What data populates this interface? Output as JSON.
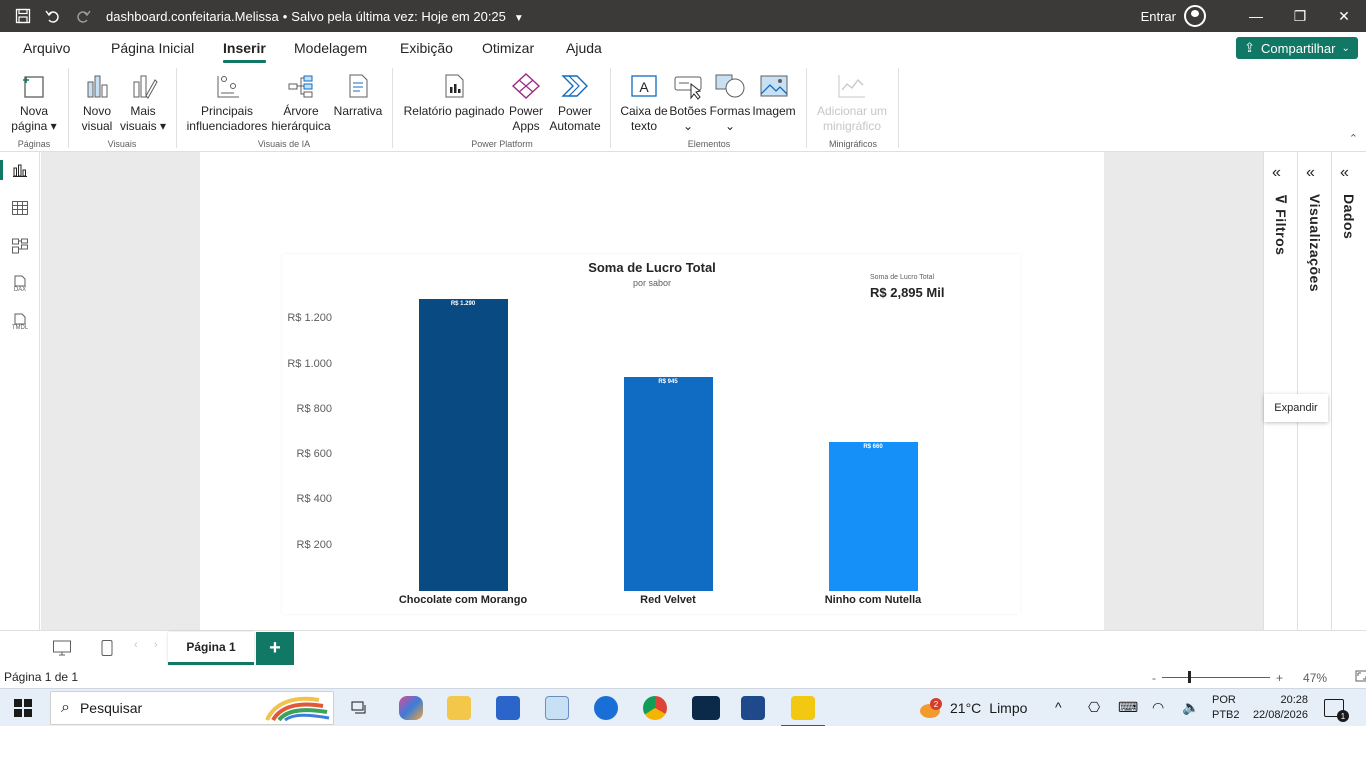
{
  "titlebar": {
    "file_name": "dashboard.confeitaria.Melissa",
    "saved_status": "Salvo pela última vez: Hoje em 20:25",
    "signin_label": "Entrar"
  },
  "menu": {
    "tabs": [
      {
        "label": "Arquivo"
      },
      {
        "label": "Página Inicial"
      },
      {
        "label": "Inserir"
      },
      {
        "label": "Modelagem"
      },
      {
        "label": "Exibição"
      },
      {
        "label": "Otimizar"
      },
      {
        "label": "Ajuda"
      }
    ],
    "share_label": "Compartilhar"
  },
  "ribbon": {
    "groups": [
      {
        "label": "Páginas"
      },
      {
        "label": "Visuais"
      },
      {
        "label": "Visuais de IA"
      },
      {
        "label": "Power Platform"
      },
      {
        "label": "Elementos"
      },
      {
        "label": "Minigráficos"
      }
    ],
    "items": [
      {
        "line1": "Nova",
        "line2": "página ▾"
      },
      {
        "line1": "Novo",
        "line2": "visual"
      },
      {
        "line1": "Mais",
        "line2": "visuais ▾"
      },
      {
        "line1": "Principais",
        "line2": "influenciadores"
      },
      {
        "line1": "Árvore",
        "line2": "hierárquica"
      },
      {
        "line1": "Narrativa",
        "line2": ""
      },
      {
        "line1": "Relatório paginado",
        "line2": ""
      },
      {
        "line1": "Power",
        "line2": "Apps"
      },
      {
        "line1": "Power",
        "line2": "Automate"
      },
      {
        "line1": "Caixa de",
        "line2": "texto"
      },
      {
        "line1": "Botões",
        "line2": "⌄"
      },
      {
        "line1": "Formas",
        "line2": "⌄"
      },
      {
        "line1": "Imagem",
        "line2": ""
      },
      {
        "line1": "Adicionar um",
        "line2": "minigráfico"
      }
    ]
  },
  "leftnav": {
    "dax_label": "DAX",
    "tmdl_label": "TMDL"
  },
  "chart_data": {
    "type": "bar",
    "title": "Soma de Lucro Total",
    "subtitle": "por sabor",
    "categories": [
      "Chocolate com Morango",
      "Red Velvet",
      "Ninho com Nutella"
    ],
    "values": [
      1290,
      945,
      660
    ],
    "data_labels": [
      "R$ 1.290",
      "R$ 945",
      "R$ 660"
    ],
    "yticks": [
      "R$ 200",
      "R$ 400",
      "R$ 600",
      "R$ 800",
      "R$ 1.000",
      "R$ 1.200"
    ],
    "ytick_values": [
      200,
      400,
      600,
      800,
      1000,
      1200
    ],
    "ylim": [
      0,
      1290
    ],
    "bar_colors": [
      "#0a4a82",
      "#0f6cc2",
      "#1590f8"
    ],
    "card": {
      "label": "Soma de Lucro Total",
      "value": "R$ 2,895 Mil"
    }
  },
  "panes": {
    "filters_label": "Filtros",
    "visualizations_label": "Visualizações",
    "data_label": "Dados",
    "tooltip": "Expandir"
  },
  "pagetabs": {
    "active_tab": "Página 1"
  },
  "statusbar": {
    "page_info": "Página 1 de 1",
    "zoom": "47%"
  },
  "taskbar": {
    "search_placeholder": "Pesquisar",
    "weather_temp": "21°C",
    "weather_desc": "Limpo",
    "weather_badge": "2",
    "lang1": "POR",
    "lang2": "PTB2",
    "time": "20:28",
    "date": "22/08/2026",
    "notif_count": "1"
  },
  "colors": {
    "accent": "#117865",
    "titlebar": "#3b3a39"
  }
}
